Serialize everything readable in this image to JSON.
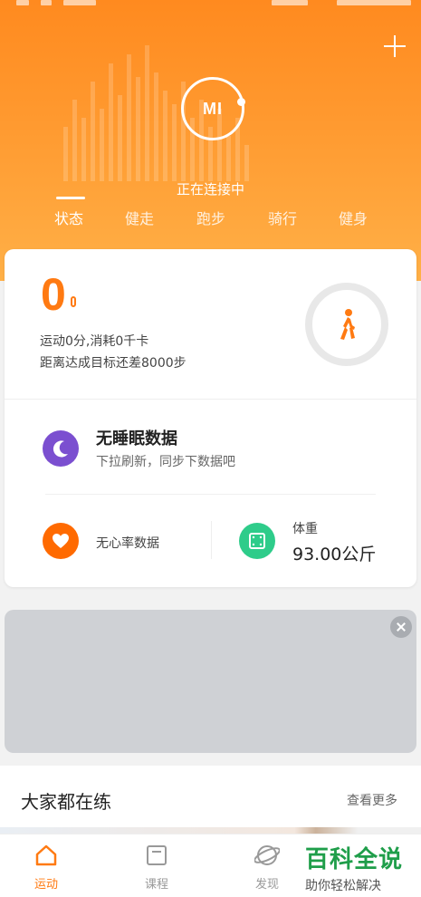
{
  "header": {
    "status_text": "正在连接中",
    "tabs": [
      {
        "label": "状态"
      },
      {
        "label": "健走"
      },
      {
        "label": "跑步"
      },
      {
        "label": "骑行"
      },
      {
        "label": "健身"
      }
    ],
    "logo_text": "MI"
  },
  "summary": {
    "steps": "0",
    "line1": "运动0分,消耗0千卡",
    "line2": "距离达成目标还差8000步"
  },
  "sleep": {
    "title": "无睡眠数据",
    "subtitle": "下拉刷新，同步下数据吧"
  },
  "heart": {
    "label": "无心率数据"
  },
  "weight": {
    "label": "体重",
    "value": "93.00公斤"
  },
  "section": {
    "title": "大家都在练",
    "more": "查看更多"
  },
  "bottom_nav": [
    {
      "label": "运动"
    },
    {
      "label": "课程"
    },
    {
      "label": "发现"
    }
  ],
  "watermark": {
    "title": "百科全说",
    "subtitle": "助你轻松解决"
  },
  "colors": {
    "accent": "#ff7a12",
    "sleep": "#7b4fd0",
    "heart": "#ff6a00",
    "weight": "#2ecc8a"
  }
}
